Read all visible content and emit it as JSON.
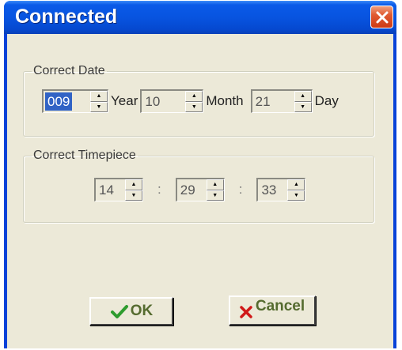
{
  "window": {
    "title": "Connected"
  },
  "date_group": {
    "legend": "Correct Date",
    "year": {
      "value": "009",
      "unit": "Year"
    },
    "month": {
      "value": "10",
      "unit": "Month"
    },
    "day": {
      "value": "21",
      "unit": "Day"
    }
  },
  "time_group": {
    "legend": "Correct Timepiece",
    "hour": "14",
    "minute": "29",
    "second": "33",
    "separator": ":"
  },
  "buttons": {
    "ok_label": "OK",
    "cancel_label": "Cancel"
  },
  "icons": {
    "close": "close-icon",
    "ok": "checkmark-icon",
    "cancel": "x-mark-icon",
    "spin_up": "arrow-up-icon",
    "spin_down": "arrow-down-icon"
  },
  "colors": {
    "titlebar": "#0854e0",
    "client": "#ece9d8",
    "close_button": "#e05a32",
    "checkmark": "#2e9c2e",
    "x_mark": "#d01818",
    "selection": "#3163c5"
  }
}
